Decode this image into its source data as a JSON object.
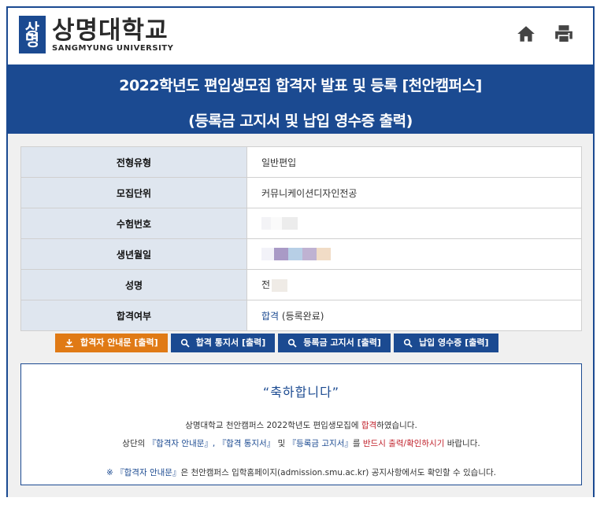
{
  "header": {
    "logo_mark": "상명",
    "logo_korean": "상명대학교",
    "logo_english": "SANGMYUNG UNIVERSITY"
  },
  "banner": {
    "title_line1": "2022학년도 편입생모집 합격자 발표 및 등록 [천안캠퍼스]",
    "title_line2": "(등록금 고지서 및 납입 영수증 출력)"
  },
  "info": {
    "rows": [
      {
        "label": "전형유형",
        "value": "일반편입"
      },
      {
        "label": "모집단위",
        "value": "커뮤니케이션디자인전공"
      },
      {
        "label": "수험번호",
        "value": ""
      },
      {
        "label": "생년월일",
        "value": ""
      },
      {
        "label": "성명",
        "value": "전"
      },
      {
        "label": "합격여부",
        "value_status": "합격",
        "value_note": "(등록완료)"
      }
    ]
  },
  "buttons": {
    "guide": "합격자 안내문 [출력]",
    "notice": "합격 통지서 [출력]",
    "bill": "등록금 고지서 [출력]",
    "receipt": "납입 영수증 [출력]"
  },
  "congrats": {
    "headline": "“축하합니다”",
    "line1_a": "상명대학교 천안캠퍼스 2022학년도 편입생모집에 ",
    "line1_b": "합격",
    "line1_c": "하였습니다.",
    "line2_a": "상단의 ",
    "line2_b": "『합격자 안내문』, 『합격 통지서』",
    "line2_c": " 및 ",
    "line2_d": "『등록금 고지서』",
    "line2_e": "를 ",
    "line2_f": "반드시 출력/확인하시기",
    "line2_g": " 바랍니다.",
    "note_a": "※ 『합격자 안내문』",
    "note_b": "은 천안캠퍼스 입학홈페이지(admission.smu.ac.kr) 공지사항에서도 확인할 수 있습니다."
  },
  "colors": {
    "brand_blue": "#1b4a91",
    "orange": "#e07a15",
    "red": "#c0202a"
  },
  "icons": [
    "home-icon",
    "print-icon",
    "download-icon",
    "search-icon"
  ]
}
